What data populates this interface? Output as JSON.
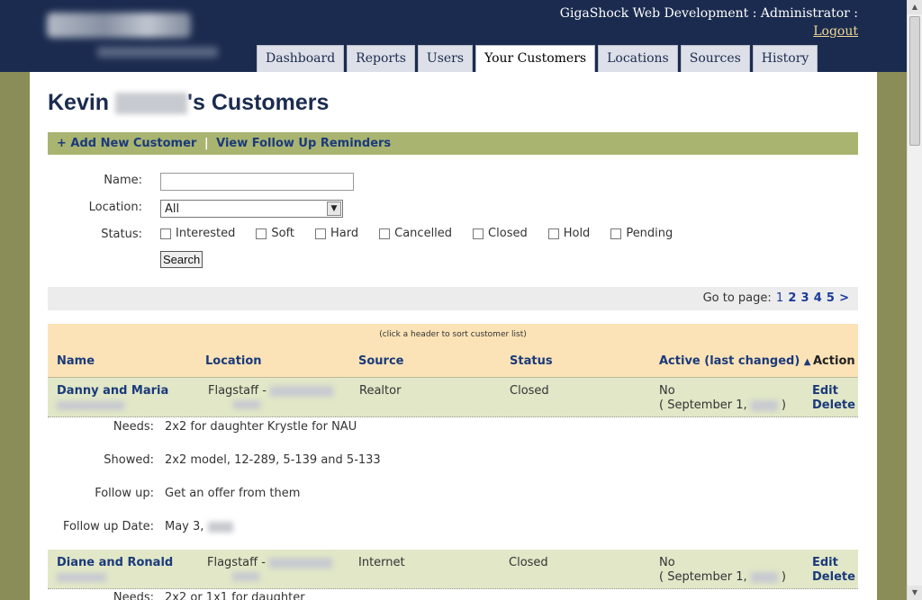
{
  "header": {
    "company": "GigaShock Web Development : Administrator :",
    "logout": "Logout"
  },
  "tabs": [
    {
      "label": "Dashboard"
    },
    {
      "label": "Reports"
    },
    {
      "label": "Users"
    },
    {
      "label": "Your Customers",
      "active": true
    },
    {
      "label": "Locations"
    },
    {
      "label": "Sources"
    },
    {
      "label": "History"
    }
  ],
  "page": {
    "title_prefix": "Kevin",
    "title_suffix": "'s Customers"
  },
  "actions": {
    "add_customer": "+ Add New Customer",
    "separator": "|",
    "follow_up": "View Follow Up Reminders"
  },
  "filters": {
    "name_label": "Name:",
    "name_value": "",
    "location_label": "Location:",
    "location_value": "All",
    "status_label": "Status:",
    "status_options": [
      "Interested",
      "Soft",
      "Hard",
      "Cancelled",
      "Closed",
      "Hold",
      "Pending"
    ],
    "search_label": "Search"
  },
  "pager": {
    "label": "Go to page:",
    "pages": [
      "1",
      "2",
      "3",
      "4",
      "5"
    ],
    "next": ">"
  },
  "table": {
    "sort_hint": "(click a header to sort customer list)",
    "columns": {
      "name": "Name",
      "location": "Location",
      "source": "Source",
      "status": "Status",
      "active": "Active (last changed)",
      "action": "Action"
    },
    "sort_arrow": "▲"
  },
  "customers": [
    {
      "name": "Danny and Maria",
      "location": "Flagstaff -",
      "source": "Realtor",
      "status": "Closed",
      "active": "No",
      "changed": "( September 1,",
      "changed_end": ")",
      "edit": "Edit",
      "delete": "Delete",
      "details": [
        {
          "label": "Needs:",
          "value": "2x2 for daughter Krystle for NAU"
        },
        {
          "label": "Showed:",
          "value": "2x2 model, 12-289, 5-139 and 5-133"
        },
        {
          "label": "Follow up:",
          "value": "Get an offer from them"
        },
        {
          "label": "Follow up Date:",
          "value": "May 3,"
        }
      ]
    },
    {
      "name": "Diane and Ronald",
      "location": "Flagstaff -",
      "source": "Internet",
      "status": "Closed",
      "active": "No",
      "changed": "( September 1,",
      "changed_end": ")",
      "edit": "Edit",
      "delete": "Delete",
      "details": [
        {
          "label": "Needs:",
          "value": "2x2 or 1x1 for daughter"
        }
      ]
    }
  ]
}
